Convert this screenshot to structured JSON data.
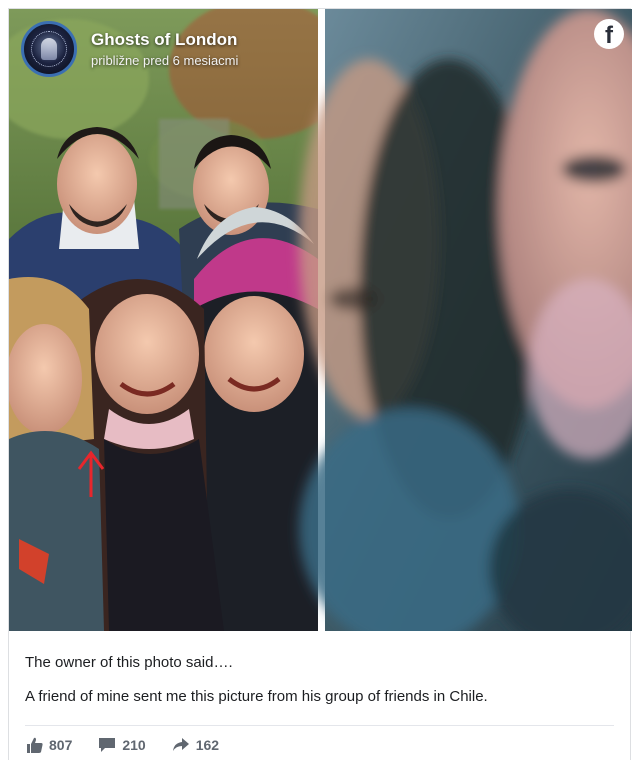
{
  "post": {
    "page_name": "Ghosts of London",
    "timestamp": "približne pred 6 mesiacmi",
    "caption_line_1": "The owner of this photo said….",
    "caption_line_2": "A friend of mine sent me this picture from his group of friends in Chile.",
    "brand_icon": "facebook-icon",
    "brand_letter": "f"
  },
  "stats": {
    "likes": "807",
    "comments": "210",
    "shares": "162"
  },
  "icons": {
    "like": "thumbs-up-icon",
    "comment": "comment-bubble-icon",
    "share": "share-arrow-icon"
  },
  "colors": {
    "page_name": "#ffffff",
    "stats_text": "#606770",
    "arrow_annotation": "#e8262c"
  }
}
